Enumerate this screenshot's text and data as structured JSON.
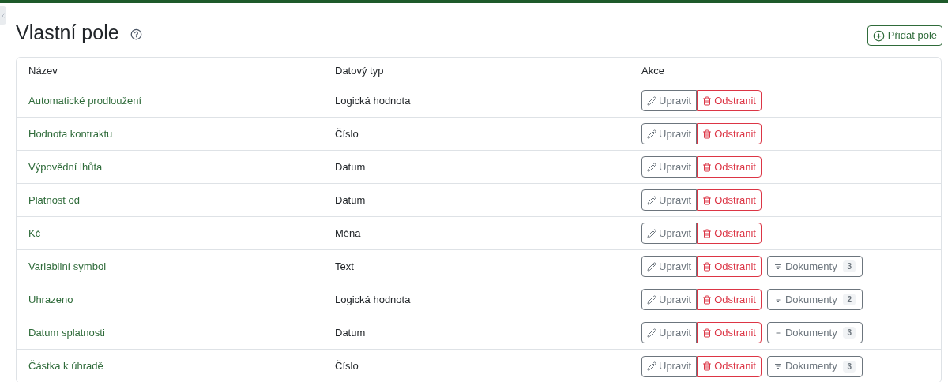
{
  "title": "Vlastní pole",
  "add_button": "Přidat pole",
  "table": {
    "columns": [
      "Název",
      "Datový typ",
      "Akce"
    ],
    "rows": [
      {
        "name": "Automatické prodloužení",
        "type": "Logická hodnota",
        "edit": "Upravit",
        "delete": "Odstranit"
      },
      {
        "name": "Hodnota kontraktu",
        "type": "Číslo",
        "edit": "Upravit",
        "delete": "Odstranit"
      },
      {
        "name": "Výpovědní lhůta",
        "type": "Datum",
        "edit": "Upravit",
        "delete": "Odstranit"
      },
      {
        "name": "Platnost od",
        "type": "Datum",
        "edit": "Upravit",
        "delete": "Odstranit"
      },
      {
        "name": "Kč",
        "type": "Měna",
        "edit": "Upravit",
        "delete": "Odstranit"
      },
      {
        "name": "Variabilní symbol",
        "type": "Text",
        "edit": "Upravit",
        "delete": "Odstranit",
        "documents": {
          "label": "Dokumenty",
          "count": "3"
        }
      },
      {
        "name": "Uhrazeno",
        "type": "Logická hodnota",
        "edit": "Upravit",
        "delete": "Odstranit",
        "documents": {
          "label": "Dokumenty",
          "count": "2"
        }
      },
      {
        "name": "Datum splatnosti",
        "type": "Datum",
        "edit": "Upravit",
        "delete": "Odstranit",
        "documents": {
          "label": "Dokumenty",
          "count": "3"
        }
      },
      {
        "name": "Částka k úhradě",
        "type": "Číslo",
        "edit": "Upravit",
        "delete": "Odstranit",
        "documents": {
          "label": "Dokumenty",
          "count": "3"
        }
      }
    ]
  }
}
